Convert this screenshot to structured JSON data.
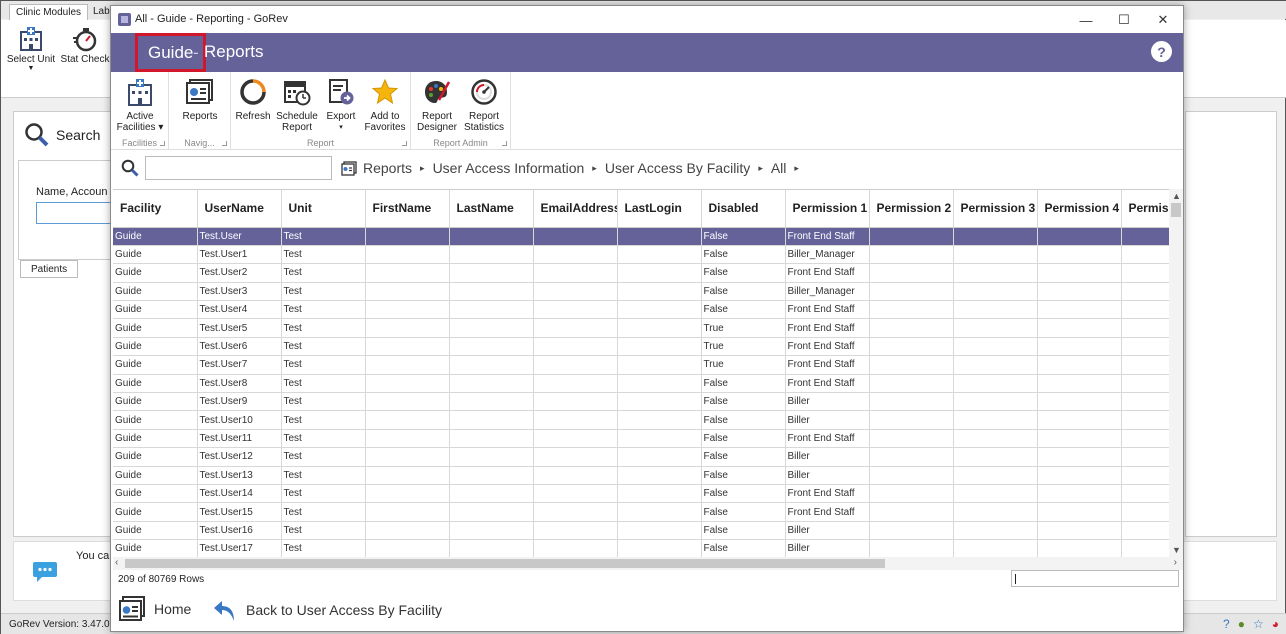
{
  "background": {
    "tabs": [
      "Clinic Modules",
      "Lab"
    ],
    "ribbon_buttons": [
      "Select Unit",
      "Stat Check"
    ],
    "search_label": "Search",
    "filter_label": "Name, Accoun",
    "patients_tab": "Patients",
    "message_text": "You ca",
    "version": "GoRev Version: 3.47.0"
  },
  "window": {
    "title": "All - Guide - Reporting - GoRev",
    "minimize": "—",
    "maximize": "☐",
    "close": "✕"
  },
  "header": {
    "crumb_guide": "Guide",
    "crumb_sep": "-",
    "crumb_reports": "Reports",
    "help": "?"
  },
  "ribbon": {
    "groups": [
      {
        "label": "Facilities",
        "buttons": [
          {
            "label1": "Active",
            "label2": "Facilities ▾"
          }
        ]
      },
      {
        "label": "Navig...",
        "buttons": [
          {
            "label1": "Reports",
            "label2": ""
          }
        ]
      },
      {
        "label": "Report",
        "buttons": [
          {
            "label1": "Refresh",
            "label2": ""
          },
          {
            "label1": "Schedule",
            "label2": "Report"
          },
          {
            "label1": "Export",
            "label2": "▾"
          },
          {
            "label1": "Add to",
            "label2": "Favorites"
          }
        ]
      },
      {
        "label": "Report Admin",
        "buttons": [
          {
            "label1": "Report",
            "label2": "Designer"
          },
          {
            "label1": "Report",
            "label2": "Statistics"
          }
        ]
      }
    ]
  },
  "search": {
    "value": "",
    "placeholder": ""
  },
  "path": [
    "Reports",
    "User Access Information",
    "User Access By Facility",
    "All"
  ],
  "grid": {
    "columns": [
      "Facility",
      "UserName",
      "Unit",
      "FirstName",
      "LastName",
      "EmailAddress",
      "LastLogin",
      "Disabled",
      "Permission 1",
      "Permission 2",
      "Permission 3",
      "Permission 4",
      "Permissi"
    ],
    "rows": [
      [
        "Guide",
        "Test.User",
        "Test",
        "",
        "",
        "",
        "",
        "False",
        "Front End Staff"
      ],
      [
        "Guide",
        "Test.User1",
        "Test",
        "",
        "",
        "",
        "",
        "False",
        "Biller_Manager"
      ],
      [
        "Guide",
        "Test.User2",
        "Test",
        "",
        "",
        "",
        "",
        "False",
        "Front End Staff"
      ],
      [
        "Guide",
        "Test.User3",
        "Test",
        "",
        "",
        "",
        "",
        "False",
        "Biller_Manager"
      ],
      [
        "Guide",
        "Test.User4",
        "Test",
        "",
        "",
        "",
        "",
        "False",
        "Front End Staff"
      ],
      [
        "Guide",
        "Test.User5",
        "Test",
        "",
        "",
        "",
        "",
        "True",
        "Front End Staff"
      ],
      [
        "Guide",
        "Test.User6",
        "Test",
        "",
        "",
        "",
        "",
        "True",
        "Front End Staff"
      ],
      [
        "Guide",
        "Test.User7",
        "Test",
        "",
        "",
        "",
        "",
        "True",
        "Front End Staff"
      ],
      [
        "Guide",
        "Test.User8",
        "Test",
        "",
        "",
        "",
        "",
        "False",
        "Front End Staff"
      ],
      [
        "Guide",
        "Test.User9",
        "Test",
        "",
        "",
        "",
        "",
        "False",
        "Biller"
      ],
      [
        "Guide",
        "Test.User10",
        "Test",
        "",
        "",
        "",
        "",
        "False",
        "Biller"
      ],
      [
        "Guide",
        "Test.User11",
        "Test",
        "",
        "",
        "",
        "",
        "False",
        "Front End Staff"
      ],
      [
        "Guide",
        "Test.User12",
        "Test",
        "",
        "",
        "",
        "",
        "False",
        "Biller"
      ],
      [
        "Guide",
        "Test.User13",
        "Test",
        "",
        "",
        "",
        "",
        "False",
        "Biller"
      ],
      [
        "Guide",
        "Test.User14",
        "Test",
        "",
        "",
        "",
        "",
        "False",
        "Front End Staff"
      ],
      [
        "Guide",
        "Test.User15",
        "Test",
        "",
        "",
        "",
        "",
        "False",
        "Front End Staff"
      ],
      [
        "Guide",
        "Test.User16",
        "Test",
        "",
        "",
        "",
        "",
        "False",
        "Biller"
      ],
      [
        "Guide",
        "Test.User17",
        "Test",
        "",
        "",
        "",
        "",
        "False",
        "Biller"
      ]
    ],
    "selected_row": 0
  },
  "row_count": "209 of 80769 Rows",
  "footer": {
    "home": "Home",
    "back": "Back to User Access By Facility"
  },
  "colors": {
    "accent": "#65629a",
    "highlight": "#d2162c"
  }
}
